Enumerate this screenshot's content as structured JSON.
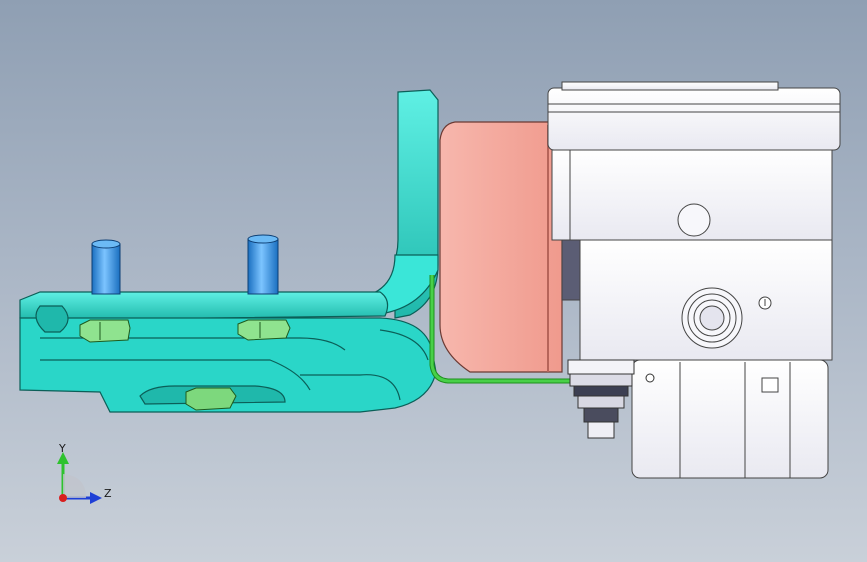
{
  "viewport": {
    "background_colors": [
      "#8f9fb3",
      "#c9d0d9"
    ]
  },
  "triad": {
    "y_label": "Y",
    "z_label": "Z",
    "y_color": "#2ec22e",
    "z_color": "#1e3fd6",
    "x_color": "#d81e1e"
  },
  "model": {
    "bracket_color": "#2ee0d0",
    "bracket_shadow_color": "#1fb8ab",
    "stud_color": "#2b8fe0",
    "nut_color": "#7fe07f",
    "pad_color": "#f5b0a6",
    "wire_color": "#2fc22f",
    "housing_color": "#f4f4f8"
  }
}
